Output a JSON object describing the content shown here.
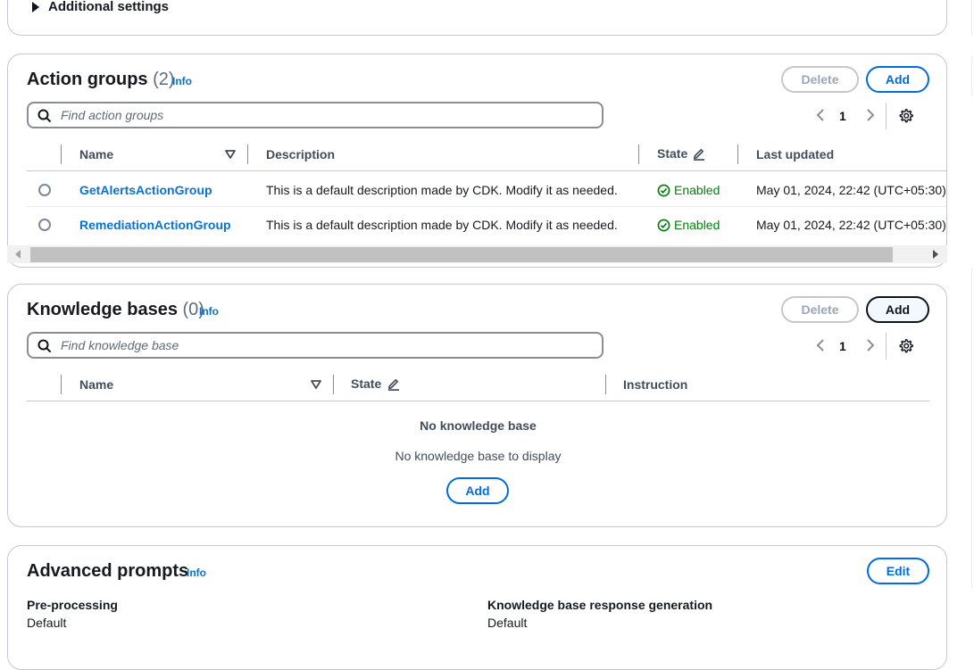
{
  "additional_settings": {
    "label": "Additional settings"
  },
  "action_groups": {
    "title": "Action groups",
    "count": "(2)",
    "info": "Info",
    "delete_label": "Delete",
    "add_label": "Add",
    "search_placeholder": "Find action groups",
    "page": "1",
    "columns": [
      "Name",
      "Description",
      "State",
      "Last updated"
    ],
    "rows": [
      {
        "name": "GetAlertsActionGroup",
        "description": "This is a default description made by CDK. Modify it as needed.",
        "state": "Enabled",
        "updated": "May 01, 2024, 22:42 (UTC+05:30)"
      },
      {
        "name": "RemediationActionGroup",
        "description": "This is a default description made by CDK. Modify it as needed.",
        "state": "Enabled",
        "updated": "May 01, 2024, 22:42 (UTC+05:30)"
      }
    ]
  },
  "knowledge_bases": {
    "title": "Knowledge bases",
    "count": "(0)",
    "info": "Info",
    "delete_label": "Delete",
    "add_label": "Add",
    "search_placeholder": "Find knowledge base",
    "page": "1",
    "columns": [
      "Name",
      "State",
      "Instruction"
    ],
    "empty_title": "No knowledge base",
    "empty_subtitle": "No knowledge base to display",
    "empty_add_label": "Add"
  },
  "advanced_prompts": {
    "title": "Advanced prompts",
    "info": "Info",
    "edit_label": "Edit",
    "items": [
      {
        "label": "Pre-processing",
        "value": "Default"
      },
      {
        "label": "Knowledge base response generation",
        "value": "Default"
      }
    ]
  },
  "colors": {
    "link": "#0972d3",
    "success": "#037f0c",
    "border": "#c6c6cd"
  },
  "icons": [
    "caret-right-icon",
    "search-icon",
    "chevron-left-icon",
    "chevron-right-icon",
    "gear-icon",
    "sort-caret-icon",
    "edit-pencil-icon",
    "check-circle-icon"
  ]
}
